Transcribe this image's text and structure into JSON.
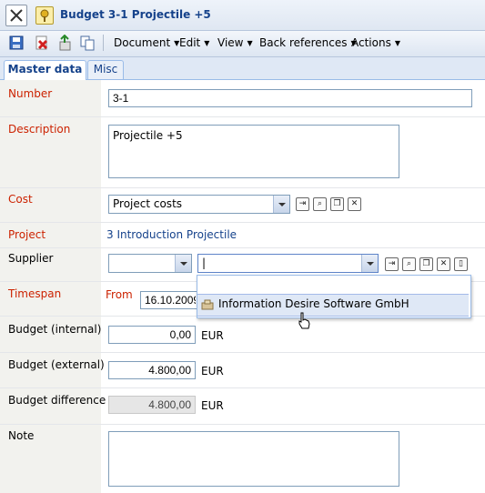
{
  "window": {
    "title": "Budget 3-1 Projectile +5"
  },
  "toolbar": {
    "icons": [
      "save-icon",
      "delete-icon",
      "new-icon",
      "copy-icon"
    ],
    "menus": [
      {
        "label": "Document"
      },
      {
        "label": "Edit"
      },
      {
        "label": "View"
      },
      {
        "label": "Back references"
      },
      {
        "label": "Actions"
      }
    ]
  },
  "tabs": [
    {
      "label": "Master data"
    },
    {
      "label": "Misc"
    }
  ],
  "form": {
    "number": {
      "label": "Number",
      "value": "3-1"
    },
    "description": {
      "label": "Description",
      "value": "Projectile +5"
    },
    "cost": {
      "label": "Cost",
      "value": "Project costs"
    },
    "project": {
      "label": "Project",
      "value": "3 Introduction Projectile"
    },
    "supplier": {
      "label": "Supplier",
      "value1": "",
      "value2": "|",
      "dropdown_options": [
        "",
        "Information Desire Software GmbH"
      ]
    },
    "timespan": {
      "label": "Timespan",
      "from_label": "From",
      "from_value": "16.10.2009"
    },
    "budget_internal": {
      "label": "Budget (internal)",
      "value": "0,00",
      "unit": "EUR"
    },
    "budget_external": {
      "label": "Budget (external)",
      "value": "4.800,00",
      "unit": "EUR"
    },
    "budget_difference": {
      "label": "Budget difference",
      "value": "4.800,00",
      "unit": "EUR"
    },
    "note": {
      "label": "Note",
      "value": ""
    }
  },
  "colors": {
    "required_label": "#cc2200",
    "link": "#15428b",
    "title": "#15428b"
  }
}
